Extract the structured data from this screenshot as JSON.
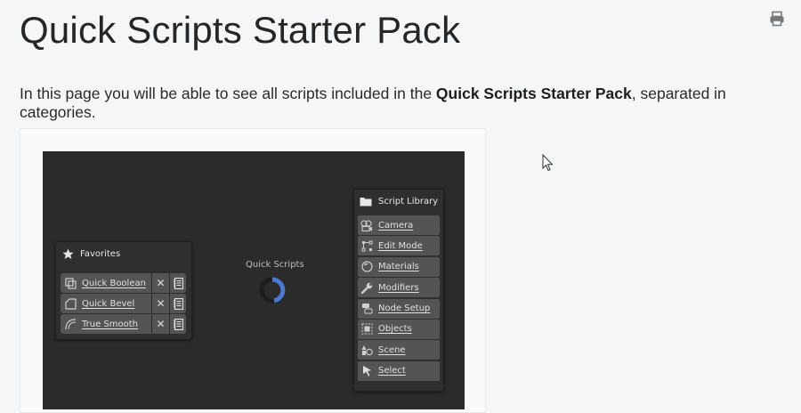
{
  "page": {
    "title": "Quick Scripts Starter Pack",
    "intro_before": "In this page you will be able to see all scripts included in the ",
    "intro_bold": "Quick Scripts Starter Pack",
    "intro_after": ", separated in categories.",
    "print_icon": "print-icon"
  },
  "addon_ui": {
    "center_label": "Quick Scripts",
    "favorites": {
      "title": "Favorites",
      "icon": "star-icon",
      "items": [
        {
          "label": "Quick Boolean",
          "icon": "boolean-icon"
        },
        {
          "label": "Quick Bevel",
          "icon": "bevel-icon"
        },
        {
          "label": "True Smooth",
          "icon": "smooth-icon"
        }
      ],
      "remove_glyph": "✕"
    },
    "library": {
      "title": "Script Library",
      "icon": "folder-icon",
      "items": [
        {
          "label": "Camera",
          "icon": "camera-icon"
        },
        {
          "label": "Edit Mode",
          "icon": "edit-mode-icon"
        },
        {
          "label": "Materials",
          "icon": "materials-icon"
        },
        {
          "label": "Modifiers",
          "icon": "wrench-icon"
        },
        {
          "label": "Node Setup",
          "icon": "node-icon"
        },
        {
          "label": "Objects",
          "icon": "object-icon"
        },
        {
          "label": "Scene",
          "icon": "scene-icon"
        },
        {
          "label": "Select",
          "icon": "select-icon"
        }
      ]
    }
  },
  "colors": {
    "page_bg": "#f5f6f8",
    "dark_bg": "#2b2b2b",
    "button_bg": "#545454",
    "spinner_accent": "#4a7bd0"
  }
}
